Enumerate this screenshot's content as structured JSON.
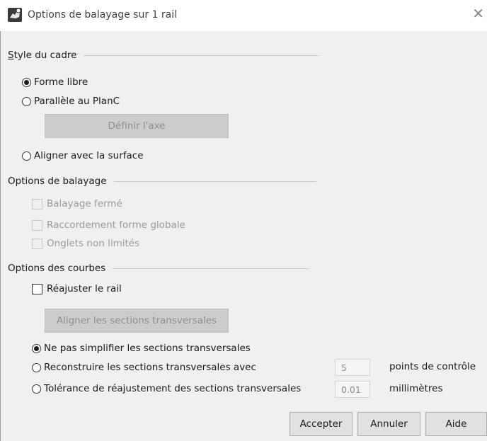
{
  "window": {
    "title": "Options de balayage sur 1 rail",
    "app_icon": "rhino-icon",
    "close_icon": "close-icon"
  },
  "frame_style": {
    "header": "Style du cadre",
    "options": [
      {
        "label": "Forme libre",
        "checked": true
      },
      {
        "label": "Parallèle au PlanC",
        "checked": false
      },
      {
        "label": "Aligner avec la surface",
        "checked": false
      }
    ],
    "define_axis_label": "Définir l'axe"
  },
  "sweep_options": {
    "header": "Options de balayage",
    "checks": [
      {
        "label": "Balayage fermé",
        "checked": false,
        "enabled": false
      },
      {
        "label": "Raccordement forme globale",
        "checked": false,
        "enabled": false
      },
      {
        "label": "Onglets non limités",
        "checked": false,
        "enabled": false
      }
    ]
  },
  "curve_options": {
    "header": "Options des courbes",
    "refit_rail": {
      "label": "Réajuster le rail",
      "checked": false
    },
    "align_cross_sections_label": "Aligner les sections transversales",
    "radios": [
      {
        "label": "Ne pas simplifier les sections transversales",
        "checked": true
      },
      {
        "label": "Reconstruire les sections transversales avec",
        "checked": false,
        "value": "5",
        "unit": "points de contrôle"
      },
      {
        "label": "Tolérance de réajustement des sections transversales",
        "checked": false,
        "value": "0.01",
        "unit": "millimètres"
      }
    ]
  },
  "buttons": {
    "ok": "Accepter",
    "cancel": "Annuler",
    "help": "Aide"
  }
}
